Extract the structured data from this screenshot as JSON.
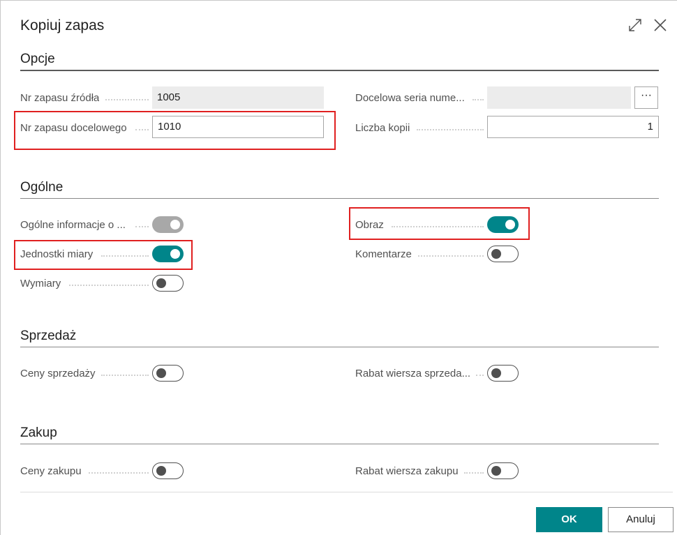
{
  "dialog": {
    "title": "Kopiuj zapas",
    "expand_icon": "expand-icon",
    "close_icon": "close-icon"
  },
  "sections": {
    "opcje": {
      "title": "Opcje",
      "source_label": "Nr zapasu źródła",
      "source_value": "1005",
      "target_label": "Nr zapasu docelowego",
      "target_value": "1010",
      "series_label": "Docelowa seria nume...",
      "series_value": "",
      "lookup_label": "···",
      "copies_label": "Liczba kopii",
      "copies_value": "1"
    },
    "ogolne": {
      "title": "Ogólne",
      "general_info_label": "Ogólne informacje o ...",
      "general_info_on": true,
      "units_label": "Jednostki miary",
      "units_on": true,
      "dimensions_label": "Wymiary",
      "dimensions_on": false,
      "picture_label": "Obraz",
      "picture_on": true,
      "comments_label": "Komentarze",
      "comments_on": false
    },
    "sprzedaz": {
      "title": "Sprzedaż",
      "sales_prices_label": "Ceny sprzedaży",
      "sales_prices_on": false,
      "sales_discount_label": "Rabat wiersza sprzeda...",
      "sales_discount_on": false
    },
    "zakup": {
      "title": "Zakup",
      "purchase_prices_label": "Ceny zakupu",
      "purchase_prices_on": false,
      "purchase_discount_label": "Rabat wiersza zakupu",
      "purchase_discount_on": false
    }
  },
  "footer": {
    "ok_label": "OK",
    "cancel_label": "Anuluj"
  },
  "colors": {
    "accent": "#00858a",
    "highlight": "#e02020"
  }
}
